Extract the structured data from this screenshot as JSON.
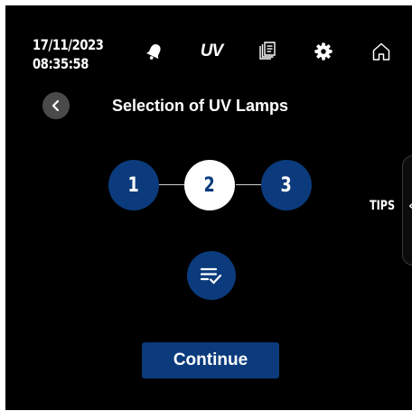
{
  "status": {
    "date": "17/11/2023",
    "time": "08:35:58"
  },
  "topbar": {
    "icons": [
      "bell-icon",
      "uv-icon",
      "documents-icon",
      "gear-icon",
      "home-icon"
    ],
    "uv_label": "UV"
  },
  "header": {
    "title": "Selection of UV Lamps"
  },
  "steps": [
    {
      "label": "1",
      "state": "pending"
    },
    {
      "label": "2",
      "state": "current"
    },
    {
      "label": "3",
      "state": "pending"
    }
  ],
  "actions": {
    "continue_label": "Continue"
  },
  "tips": {
    "label": "TIPS",
    "arrow": "«"
  },
  "colors": {
    "background": "#000000",
    "accent": "#0b3b7c",
    "text": "#ffffff",
    "back_button": "#4a4a4a"
  }
}
